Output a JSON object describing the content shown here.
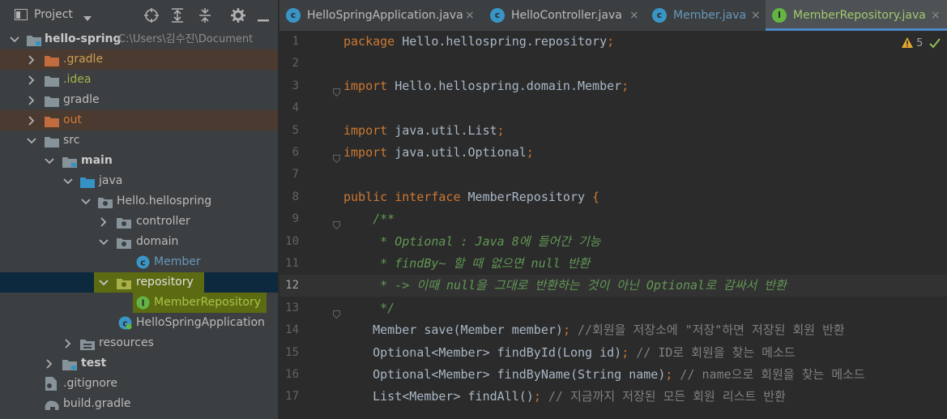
{
  "project": {
    "title": "Project",
    "root": {
      "name": "hello-spring",
      "path": "C:\\Users\\김수진\\Document"
    },
    "items": [
      {
        "label": ".gradle"
      },
      {
        "label": ".idea"
      },
      {
        "label": "gradle"
      },
      {
        "label": "out"
      },
      {
        "label": "src"
      },
      {
        "label": "main"
      },
      {
        "label": "java"
      },
      {
        "label": "Hello.hellospring"
      },
      {
        "label": "controller"
      },
      {
        "label": "domain"
      },
      {
        "label": "Member"
      },
      {
        "label": "repository"
      },
      {
        "label": "MemberRepository"
      },
      {
        "label": "HelloSpringApplication"
      },
      {
        "label": "resources"
      },
      {
        "label": "test"
      },
      {
        "label": ".gitignore"
      },
      {
        "label": "build.gradle"
      }
    ]
  },
  "tabs": [
    {
      "label": "HelloSpringApplication.java"
    },
    {
      "label": "HelloController.java"
    },
    {
      "label": "Member.java"
    },
    {
      "label": "MemberRepository.java"
    }
  ],
  "editor": {
    "warnings": "5",
    "caret_line": 12,
    "lines": [
      {
        "n": "1",
        "a": "package",
        "b": " Hello.hellospring.repository",
        "c": ";"
      },
      {
        "n": "2"
      },
      {
        "n": "3",
        "a": "import",
        "b": " Hello.hellospring.domain.Member",
        "c": ";"
      },
      {
        "n": "4"
      },
      {
        "n": "5",
        "a": "import",
        "b": " java.util.List",
        "c": ";"
      },
      {
        "n": "6",
        "a": "import",
        "b": " java.util.Optional",
        "c": ";"
      },
      {
        "n": "7"
      },
      {
        "n": "8",
        "a": "public interface",
        "b": " MemberRepository",
        "c": " {"
      },
      {
        "n": "9",
        "cm": "    /**"
      },
      {
        "n": "10",
        "cm": "     * Optional : Java 8에 들어간 기능"
      },
      {
        "n": "11",
        "cm": "     * findBy~ 할 때 없으면 null 반환"
      },
      {
        "n": "12",
        "cm": "     * -> 이때 null을 그대로 반환하는 것이 아닌 Optional로 감싸서 반환"
      },
      {
        "n": "13",
        "cm": "     */"
      },
      {
        "n": "14",
        "d": "    Member ",
        "e": "save",
        "f": "(Member member)",
        "g": ";",
        "h": " //회원을 저장소에 \"저장\"하면 저장된 회원 반환"
      },
      {
        "n": "15",
        "d": "    Optional<Member> ",
        "e": "findById",
        "f": "(Long id)",
        "g": ";",
        "h": " // ID로 회원을 찾는 메소드"
      },
      {
        "n": "16",
        "d": "    Optional<Member> ",
        "e": "findByName",
        "f": "(String name)",
        "g": ";",
        "h": " // name으로 회원을 찾는 메소드"
      },
      {
        "n": "17",
        "d": "    List<Member> ",
        "e": "findAll",
        "f": "()",
        "g": ";",
        "h": " // 지금까지 저장된 모든 회원 리스트 반환"
      }
    ]
  },
  "colors": {
    "sidebar_bg": "#3c3f41",
    "editor_bg": "#2b2b2b",
    "keyword": "#cc7832",
    "comment": "#629755",
    "ignored_folder": "#4b3a2f",
    "selection": "#0d293e",
    "highlight": "#5c6b12",
    "active_tab_text": "#a0c96f"
  }
}
